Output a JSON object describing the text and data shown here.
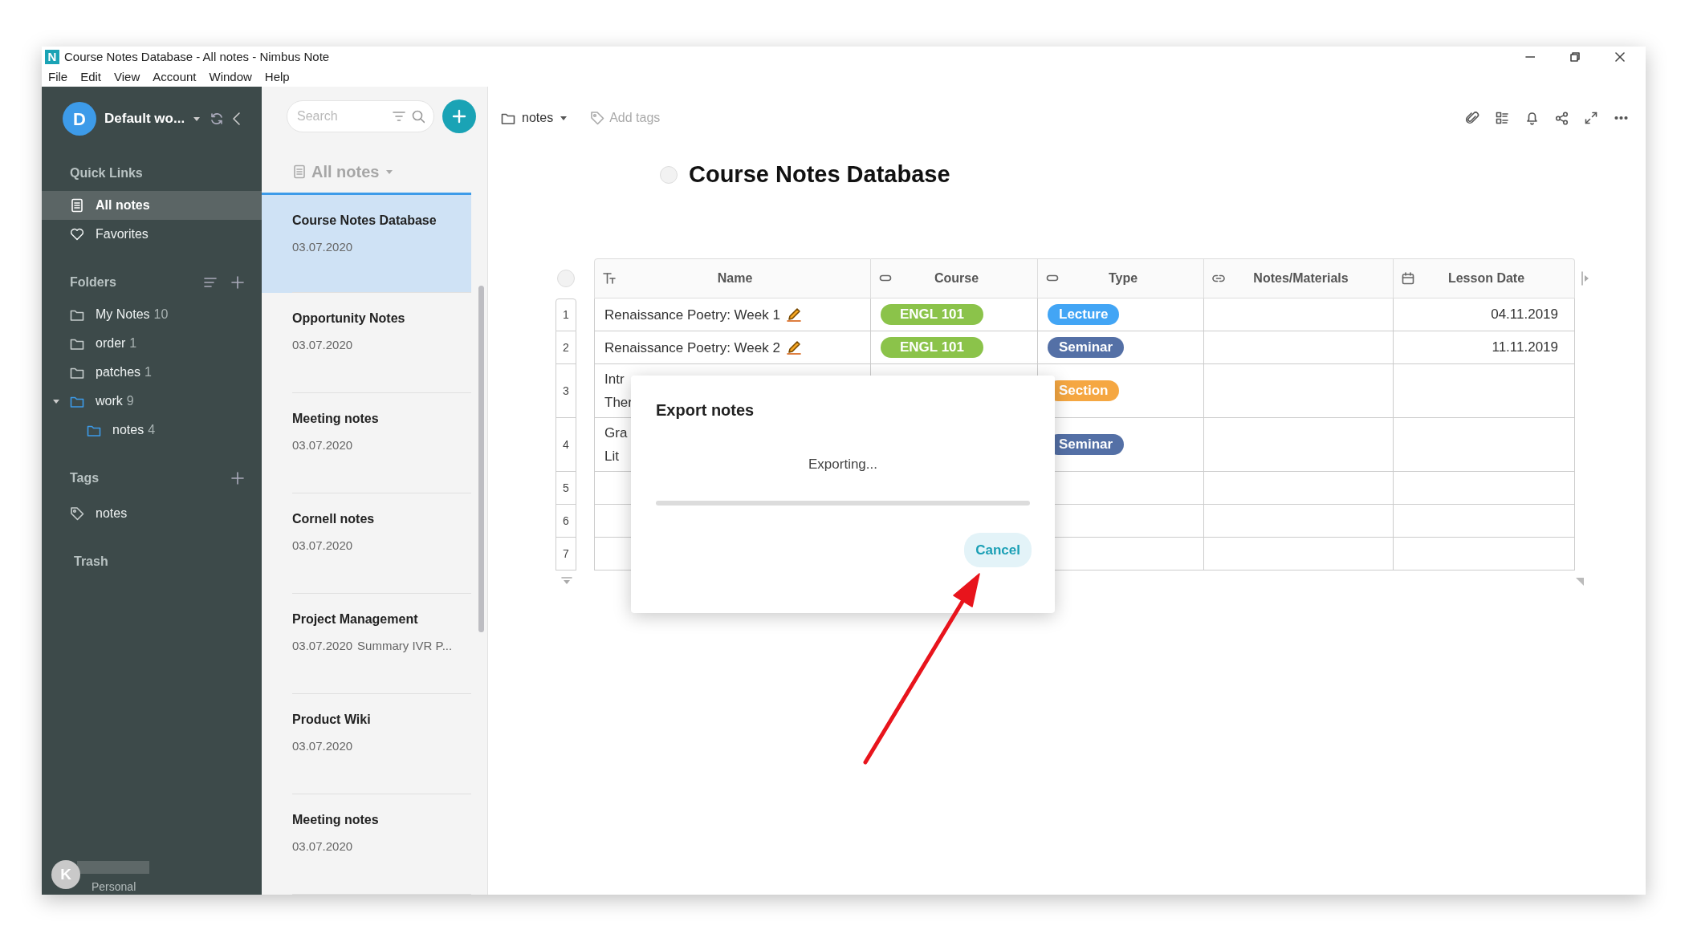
{
  "window": {
    "logo": "N",
    "title": "Course Notes Database - All notes - Nimbus Note"
  },
  "menu": [
    "File",
    "Edit",
    "View",
    "Account",
    "Window",
    "Help"
  ],
  "sidebar": {
    "workspace": {
      "avatar": "D",
      "name": "Default wo..."
    },
    "quick_links": {
      "title": "Quick Links",
      "items": [
        {
          "label": "All notes",
          "kind": "notes",
          "selected": true
        },
        {
          "label": "Favorites",
          "kind": "favorites",
          "selected": false
        }
      ]
    },
    "folders": {
      "title": "Folders",
      "items": [
        {
          "label": "My Notes",
          "count": "10",
          "highlighted": false
        },
        {
          "label": "order",
          "count": "1",
          "highlighted": false
        },
        {
          "label": "patches",
          "count": "1",
          "highlighted": false
        },
        {
          "label": "work",
          "count": "9",
          "highlighted": true,
          "expanded": true,
          "children": [
            {
              "label": "notes",
              "count": "4",
              "highlighted": true
            }
          ]
        }
      ]
    },
    "tags": {
      "title": "Tags",
      "items": [
        {
          "label": "notes"
        }
      ]
    },
    "trash": "Trash",
    "user": {
      "avatar": "K",
      "plan": "Personal"
    }
  },
  "note_list": {
    "search": {
      "placeholder": "Search"
    },
    "title": "All notes",
    "notes": [
      {
        "title": "Course Notes Database",
        "date": "03.07.2020",
        "selected": true
      },
      {
        "title": "Opportunity Notes",
        "date": "03.07.2020",
        "selected": false
      },
      {
        "title": "Meeting notes",
        "date": "03.07.2020",
        "selected": false
      },
      {
        "title": "Cornell notes",
        "date": "03.07.2020",
        "selected": false
      },
      {
        "title": "Project Management",
        "date": "03.07.2020",
        "snippet": "Summary IVR P...",
        "selected": false
      },
      {
        "title": "Product Wiki",
        "date": "03.07.2020",
        "selected": false
      },
      {
        "title": "Meeting notes",
        "date": "03.07.2020",
        "selected": false
      }
    ]
  },
  "editor": {
    "folder": "notes",
    "tags_placeholder": "Add tags",
    "title": "Course Notes Database",
    "title_checked": false,
    "table": {
      "all_selected": false,
      "columns": [
        {
          "name": "Name",
          "kind": "text"
        },
        {
          "name": "Course",
          "kind": "tag"
        },
        {
          "name": "Type",
          "kind": "tag"
        },
        {
          "name": "Notes/Materials",
          "kind": "link"
        },
        {
          "name": "Lesson Date",
          "kind": "date"
        }
      ],
      "rows": [
        {
          "number": "1",
          "name": [
            "Renaissance Poetry:  Week 1"
          ],
          "edited": true,
          "course": "ENGL 101",
          "type": {
            "label": "Lecture",
            "color": "#42a5f5"
          },
          "lesson_date": "04.11.2019"
        },
        {
          "number": "2",
          "name": [
            "Renaissance Poetry: Week 2"
          ],
          "edited": true,
          "course": "ENGL 101",
          "type": {
            "label": "Seminar",
            "color": "#5470a6"
          },
          "lesson_date": "11.11.2019"
        },
        {
          "number": "3",
          "name": [
            "Intr",
            "Ther"
          ],
          "type": {
            "label": "Section",
            "color": "#f5a742"
          }
        },
        {
          "number": "4",
          "name": [
            "Gra",
            "Lit"
          ],
          "type": {
            "label": "Seminar",
            "color": "#5470a6"
          }
        },
        {
          "number": "5"
        },
        {
          "number": "6"
        },
        {
          "number": "7"
        }
      ]
    }
  },
  "dialog": {
    "title": "Export notes",
    "message": "Exporting...",
    "progress": {
      "level": 0
    },
    "cancel": "Cancel"
  }
}
